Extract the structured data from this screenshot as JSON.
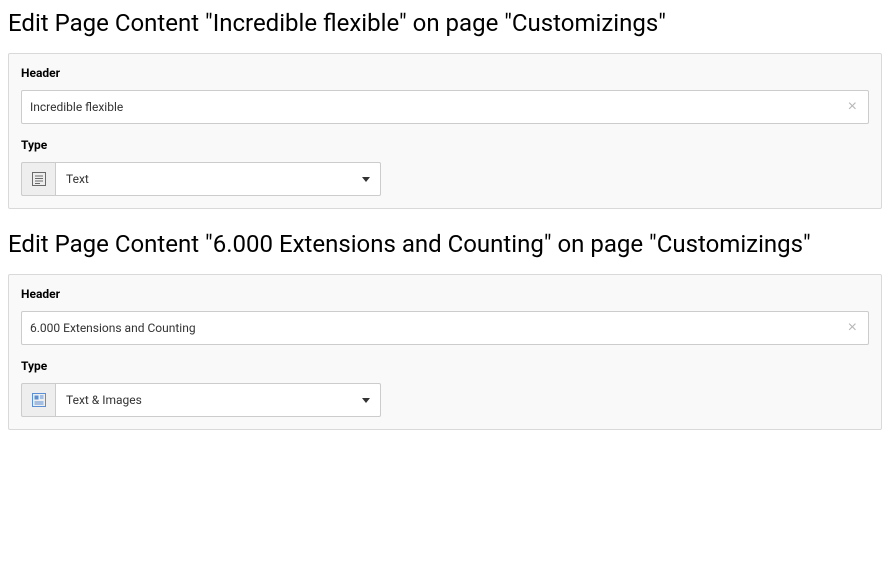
{
  "sections": [
    {
      "title": "Edit Page Content \"Incredible flexible\" on page \"Customizings\"",
      "header_label": "Header",
      "header_value": "Incredible flexible",
      "type_label": "Type",
      "type_value": "Text",
      "type_kind": "text"
    },
    {
      "title": "Edit Page Content \"6.000 Extensions and Counting\" on page \"Customizings\"",
      "header_label": "Header",
      "header_value": "6.000 Extensions and Counting",
      "type_label": "Type",
      "type_value": "Text & Images",
      "type_kind": "text-images"
    }
  ]
}
